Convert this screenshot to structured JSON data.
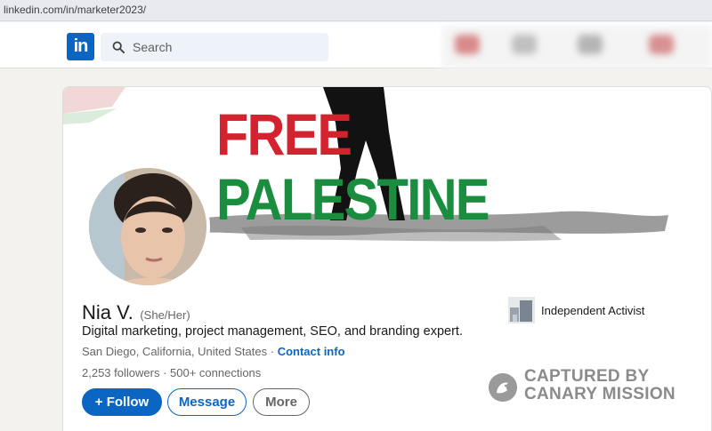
{
  "browser": {
    "url": "linkedin.com/in/marketer2023/"
  },
  "nav": {
    "logo": "in",
    "search_placeholder": "Search"
  },
  "banner": {
    "line1": "FREE",
    "line2": "PALESTINE"
  },
  "profile": {
    "name": "Nia V.",
    "pronouns": "(She/Her)",
    "headline": "Digital marketing, project management, SEO, and branding expert.",
    "location": "San Diego, California, United States",
    "location_sep": " · ",
    "contact": "Contact info",
    "followers": "2,253 followers",
    "stats_sep": " · ",
    "connections": "500+ connections",
    "org": "Independent Activist"
  },
  "actions": {
    "follow": "+ Follow",
    "message": "Message",
    "more": "More"
  },
  "watermark": {
    "line1": "CAPTURED BY",
    "line2": "CANARY MISSION"
  },
  "colors": {
    "brand": "#0a66c2",
    "red": "#d3232e",
    "green": "#1a8d3f"
  }
}
